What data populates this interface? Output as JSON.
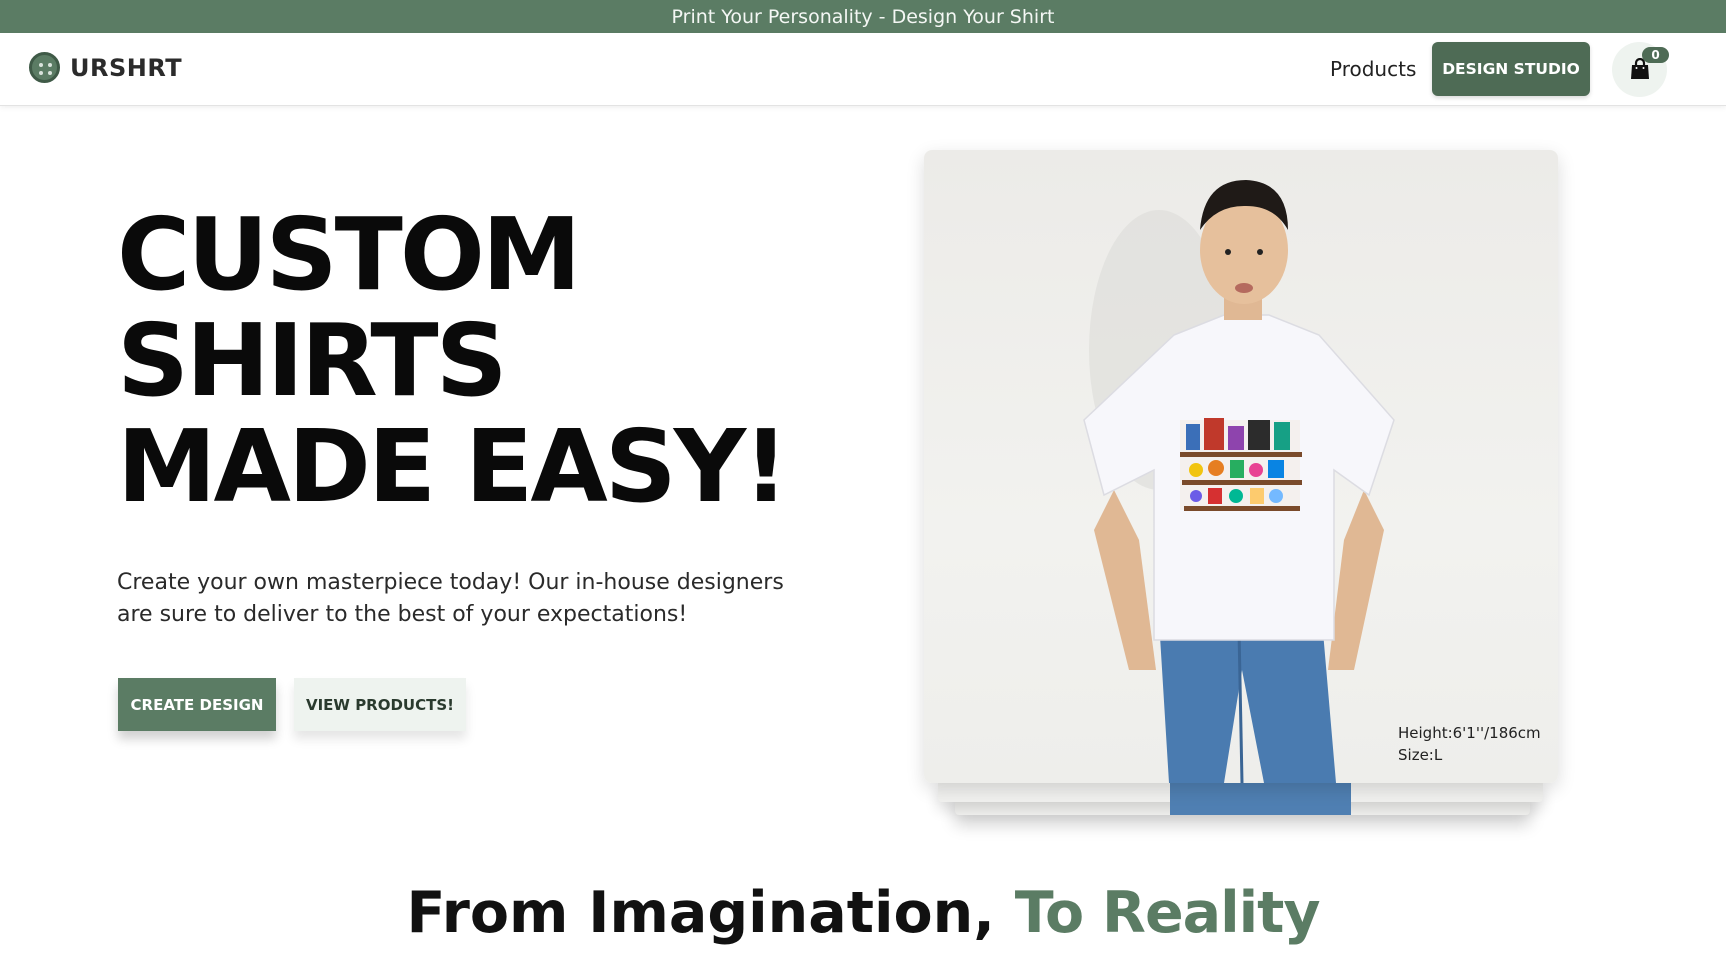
{
  "promo": {
    "text": "Print Your Personality - Design Your Shirt"
  },
  "nav": {
    "brand": "URSHRT",
    "links": [
      "Products"
    ],
    "design_studio": "DESIGN STUDIO",
    "cart_count": "0"
  },
  "hero": {
    "title_lines": [
      "CUSTOM",
      "SHIRTS",
      "MADE EASY!"
    ],
    "subtitle_line1": "Create your own masterpiece today! Our in-house designers",
    "subtitle_line2": "are sure to deliver to the best of your expectations!",
    "primary_cta": "CREATE DESIGN",
    "secondary_cta": "VIEW PRODUCTS!",
    "model_height": "Height:6'1''/186cm",
    "model_size": "Size:L"
  },
  "section": {
    "heading_plain": "From Imagination, ",
    "heading_accent": "To Reality"
  },
  "colors": {
    "brand_green": "#5b7c64",
    "brand_green_dark": "#4e6b55",
    "light_green": "#eef3ef"
  },
  "icons": [
    "brand-logo-icon",
    "shopping-bag-icon"
  ]
}
